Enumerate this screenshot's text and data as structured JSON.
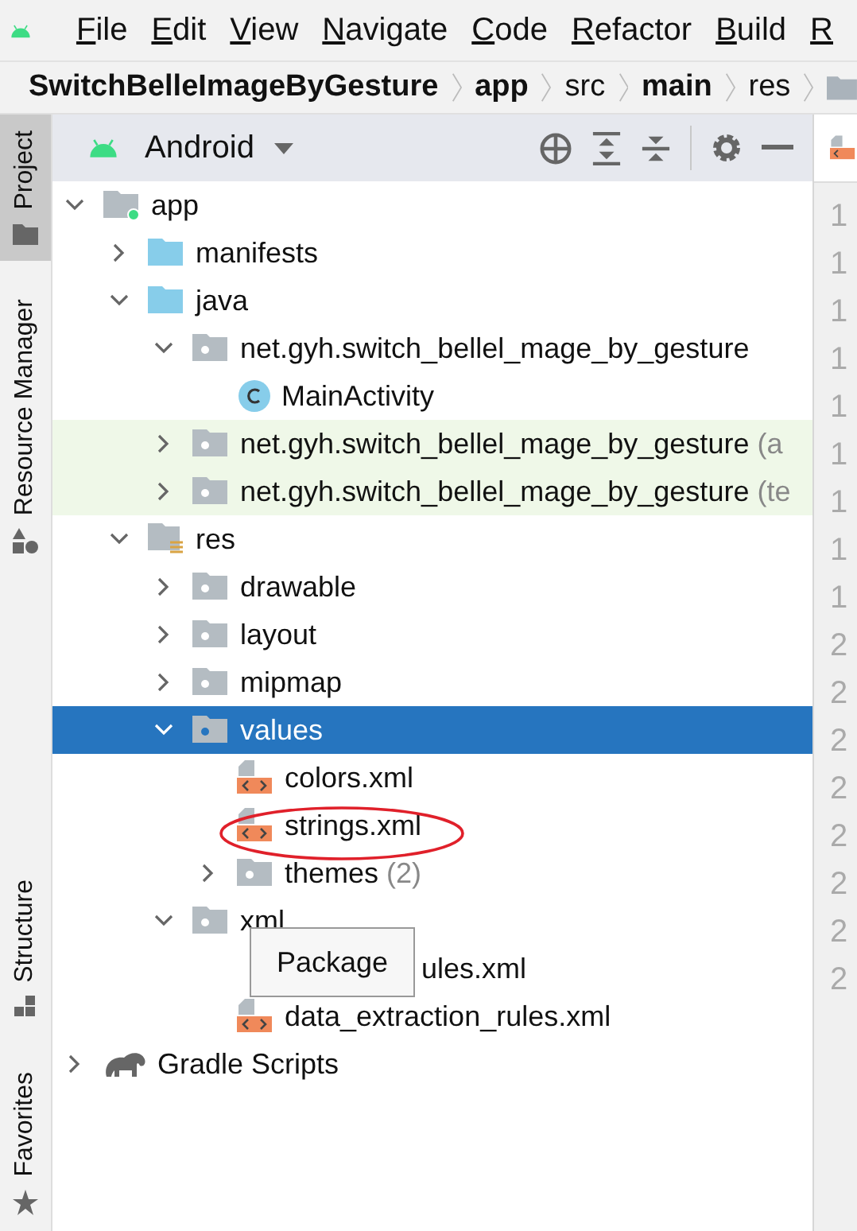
{
  "menu": [
    {
      "label": "File"
    },
    {
      "label": "Edit"
    },
    {
      "label": "View"
    },
    {
      "label": "Navigate"
    },
    {
      "label": "Code"
    },
    {
      "label": "Refactor"
    },
    {
      "label": "Build"
    },
    {
      "label": "R"
    }
  ],
  "breadcrumb": [
    {
      "label": "SwitchBelleImageByGesture",
      "bold": true
    },
    {
      "label": "app",
      "bold": true
    },
    {
      "label": "src",
      "bold": false
    },
    {
      "label": "main",
      "bold": true
    },
    {
      "label": "res",
      "bold": false
    }
  ],
  "tool_window_bar": [
    {
      "label": "Project",
      "selected": true
    },
    {
      "label": "Resource Manager",
      "selected": false
    },
    {
      "label": "Structure",
      "selected": false
    },
    {
      "label": "Favorites",
      "selected": false
    }
  ],
  "project_panel": {
    "view": "Android",
    "tree": [
      {
        "kind": "module",
        "label": "app",
        "expanded": true,
        "selected": false,
        "children": [
          {
            "kind": "source_folder",
            "label": "manifests",
            "expanded": false,
            "selected": false
          },
          {
            "kind": "source_folder",
            "label": "java",
            "expanded": true,
            "selected": false,
            "children": [
              {
                "kind": "package",
                "label": "net.gyh.switch_bellel_mage_by_gesture",
                "expanded": true,
                "selected": false,
                "children": [
                  {
                    "kind": "class",
                    "label": "MainActivity",
                    "selected": false
                  }
                ]
              },
              {
                "kind": "package",
                "label": "net.gyh.switch_bellel_mage_by_gesture",
                "suffix": "(a",
                "expanded": false,
                "selected": false,
                "test": true
              },
              {
                "kind": "package",
                "label": "net.gyh.switch_bellel_mage_by_gesture",
                "suffix": "(te",
                "expanded": false,
                "selected": false,
                "test": true
              }
            ]
          },
          {
            "kind": "res_folder",
            "label": "res",
            "expanded": true,
            "selected": false,
            "children": [
              {
                "kind": "package",
                "label": "drawable",
                "expanded": false,
                "selected": false
              },
              {
                "kind": "package",
                "label": "layout",
                "expanded": false,
                "selected": false
              },
              {
                "kind": "package",
                "label": "mipmap",
                "expanded": false,
                "selected": false
              },
              {
                "kind": "package",
                "label": "values",
                "expanded": true,
                "selected": true,
                "children": [
                  {
                    "kind": "xml",
                    "label": "colors.xml",
                    "selected": false
                  },
                  {
                    "kind": "xml",
                    "label": "strings.xml",
                    "selected": false
                  },
                  {
                    "kind": "package",
                    "label": "themes",
                    "suffix": "(2)",
                    "expanded": false,
                    "selected": false
                  }
                ]
              },
              {
                "kind": "package",
                "label": "xml",
                "expanded": true,
                "selected": false,
                "children": [
                  {
                    "label": "ules.xml",
                    "selected": false,
                    "covered": true
                  },
                  {
                    "kind": "xml",
                    "label": "data_extraction_rules.xml",
                    "selected": false
                  }
                ]
              }
            ]
          }
        ]
      },
      {
        "kind": "gradle",
        "label": "Gradle Scripts",
        "expanded": false,
        "selected": false
      }
    ],
    "tooltip": "Package"
  },
  "gutter": [
    "1",
    "1",
    "1",
    "1",
    "1",
    "1",
    "1",
    "1",
    "1",
    "2",
    "2",
    "2",
    "2",
    "2",
    "2",
    "2",
    "2"
  ]
}
